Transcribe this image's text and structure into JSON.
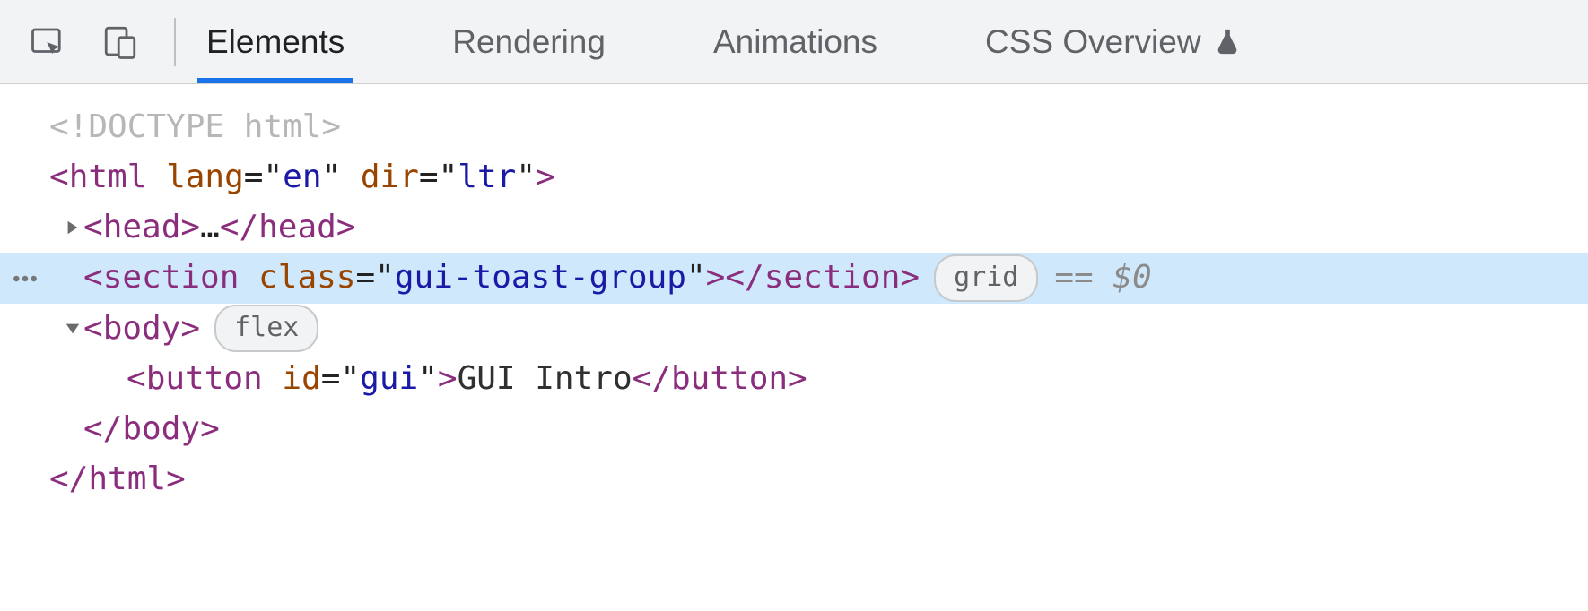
{
  "toolbar": {
    "tabs": [
      "Elements",
      "Rendering",
      "Animations",
      "CSS Overview"
    ],
    "active_tab": "Elements"
  },
  "dom": {
    "line_doctype": "<!DOCTYPE html>",
    "html_open": {
      "tag": "html",
      "attrs": [
        [
          "lang",
          "en"
        ],
        [
          "dir",
          "ltr"
        ]
      ]
    },
    "head": {
      "tag": "head",
      "collapsed_text": "…"
    },
    "section": {
      "tag": "section",
      "attrs": [
        [
          "class",
          "gui-toast-group"
        ]
      ],
      "badge": "grid",
      "ref": "== $0"
    },
    "body": {
      "tag": "body",
      "badge": "flex"
    },
    "button": {
      "tag": "button",
      "attrs": [
        [
          "id",
          "gui"
        ]
      ],
      "text": " GUI Intro "
    },
    "body_close": "body",
    "html_close": "html"
  }
}
